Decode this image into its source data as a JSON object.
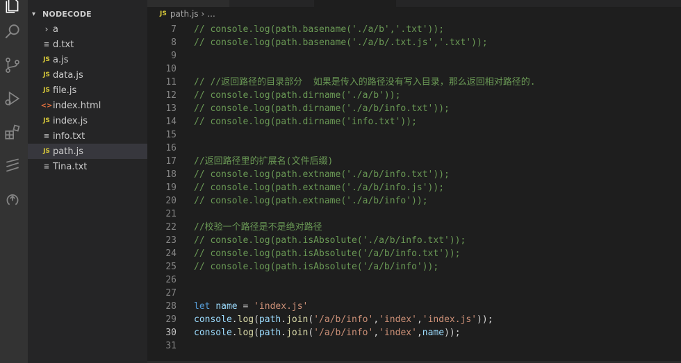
{
  "explorer": {
    "title": "NODECODE",
    "items": [
      {
        "label": "a",
        "type": "folder"
      },
      {
        "label": "d.txt",
        "type": "txt"
      },
      {
        "label": "a.js",
        "type": "js"
      },
      {
        "label": "data.js",
        "type": "js"
      },
      {
        "label": "file.js",
        "type": "js"
      },
      {
        "label": "index.html",
        "type": "html"
      },
      {
        "label": "index.js",
        "type": "js"
      },
      {
        "label": "info.txt",
        "type": "txt"
      },
      {
        "label": "path.js",
        "type": "js",
        "selected": true
      },
      {
        "label": "Tina.txt",
        "type": "txt"
      }
    ]
  },
  "icons": {
    "folder_chevron": "›",
    "js_badge": "JS",
    "html_badge": "<>",
    "text_lines": "≡"
  },
  "breadcrumb": {
    "badge": "JS",
    "file": "path.js",
    "separator": "›",
    "more": "..."
  },
  "editor": {
    "active_line": 30,
    "lines": [
      {
        "n": 7,
        "tokens": [
          {
            "t": "comment",
            "v": "// console.log(path.basename('./a/b','.txt'));"
          }
        ]
      },
      {
        "n": 8,
        "tokens": [
          {
            "t": "comment",
            "v": "// console.log(path.basename('./a/b/.txt.js','.txt'));"
          }
        ]
      },
      {
        "n": 9,
        "tokens": []
      },
      {
        "n": 10,
        "tokens": []
      },
      {
        "n": 11,
        "tokens": [
          {
            "t": "comment",
            "v": "// //返回路径的目录部分  如果是传入的路径没有写入目录，那么返回相对路径的."
          }
        ]
      },
      {
        "n": 12,
        "tokens": [
          {
            "t": "comment",
            "v": "// console.log(path.dirname('./a/b'));"
          }
        ]
      },
      {
        "n": 13,
        "tokens": [
          {
            "t": "comment",
            "v": "// console.log(path.dirname('./a/b/info.txt'));"
          }
        ]
      },
      {
        "n": 14,
        "tokens": [
          {
            "t": "comment",
            "v": "// console.log(path.dirname('info.txt'));"
          }
        ]
      },
      {
        "n": 15,
        "tokens": []
      },
      {
        "n": 16,
        "tokens": []
      },
      {
        "n": 17,
        "tokens": [
          {
            "t": "comment",
            "v": "//返回路径里的扩展名(文件后缀)"
          }
        ]
      },
      {
        "n": 18,
        "tokens": [
          {
            "t": "comment",
            "v": "// console.log(path.extname('./a/b/info.txt'));"
          }
        ]
      },
      {
        "n": 19,
        "tokens": [
          {
            "t": "comment",
            "v": "// console.log(path.extname('./a/b/info.js'));"
          }
        ]
      },
      {
        "n": 20,
        "tokens": [
          {
            "t": "comment",
            "v": "// console.log(path.extname('./a/b/info'));"
          }
        ]
      },
      {
        "n": 21,
        "tokens": []
      },
      {
        "n": 22,
        "tokens": [
          {
            "t": "comment",
            "v": "//校验一个路径是不是绝对路径"
          }
        ]
      },
      {
        "n": 23,
        "tokens": [
          {
            "t": "comment",
            "v": "// console.log(path.isAbsolute('./a/b/info.txt'));"
          }
        ]
      },
      {
        "n": 24,
        "tokens": [
          {
            "t": "comment",
            "v": "// console.log(path.isAbsolute('/a/b/info.txt'));"
          }
        ]
      },
      {
        "n": 25,
        "tokens": [
          {
            "t": "comment",
            "v": "// console.log(path.isAbsolute('/a/b/info'));"
          }
        ]
      },
      {
        "n": 26,
        "tokens": []
      },
      {
        "n": 27,
        "tokens": []
      },
      {
        "n": 28,
        "tokens": [
          {
            "t": "kw",
            "v": "let"
          },
          {
            "t": "punct",
            "v": " "
          },
          {
            "t": "var",
            "v": "name"
          },
          {
            "t": "punct",
            "v": " = "
          },
          {
            "t": "str",
            "v": "'index.js'"
          }
        ]
      },
      {
        "n": 29,
        "tokens": [
          {
            "t": "var",
            "v": "console"
          },
          {
            "t": "punct",
            "v": "."
          },
          {
            "t": "fn",
            "v": "log"
          },
          {
            "t": "punct",
            "v": "("
          },
          {
            "t": "var",
            "v": "path"
          },
          {
            "t": "punct",
            "v": "."
          },
          {
            "t": "fn",
            "v": "join"
          },
          {
            "t": "punct",
            "v": "("
          },
          {
            "t": "str",
            "v": "'/a/b/info'"
          },
          {
            "t": "punct",
            "v": ","
          },
          {
            "t": "str",
            "v": "'index'"
          },
          {
            "t": "punct",
            "v": ","
          },
          {
            "t": "str",
            "v": "'index.js'"
          },
          {
            "t": "punct",
            "v": "));"
          }
        ]
      },
      {
        "n": 30,
        "tokens": [
          {
            "t": "var",
            "v": "console"
          },
          {
            "t": "punct",
            "v": "."
          },
          {
            "t": "fn",
            "v": "log"
          },
          {
            "t": "punct",
            "v": "("
          },
          {
            "t": "var",
            "v": "path"
          },
          {
            "t": "punct",
            "v": "."
          },
          {
            "t": "fn",
            "v": "join"
          },
          {
            "t": "punct",
            "v": "("
          },
          {
            "t": "str",
            "v": "'/a/b/info'"
          },
          {
            "t": "punct",
            "v": ","
          },
          {
            "t": "str",
            "v": "'index'"
          },
          {
            "t": "punct",
            "v": ","
          },
          {
            "t": "var",
            "v": "name"
          },
          {
            "t": "punct",
            "v": "));"
          }
        ]
      },
      {
        "n": 31,
        "tokens": []
      }
    ]
  },
  "colors": {
    "comment": "#6a9955",
    "keyword": "#569cd6",
    "variable": "#9cdcfe",
    "string": "#ce9178",
    "function": "#dcdcaa",
    "js_badge": "#d8c93a",
    "html_badge": "#e0703e"
  }
}
